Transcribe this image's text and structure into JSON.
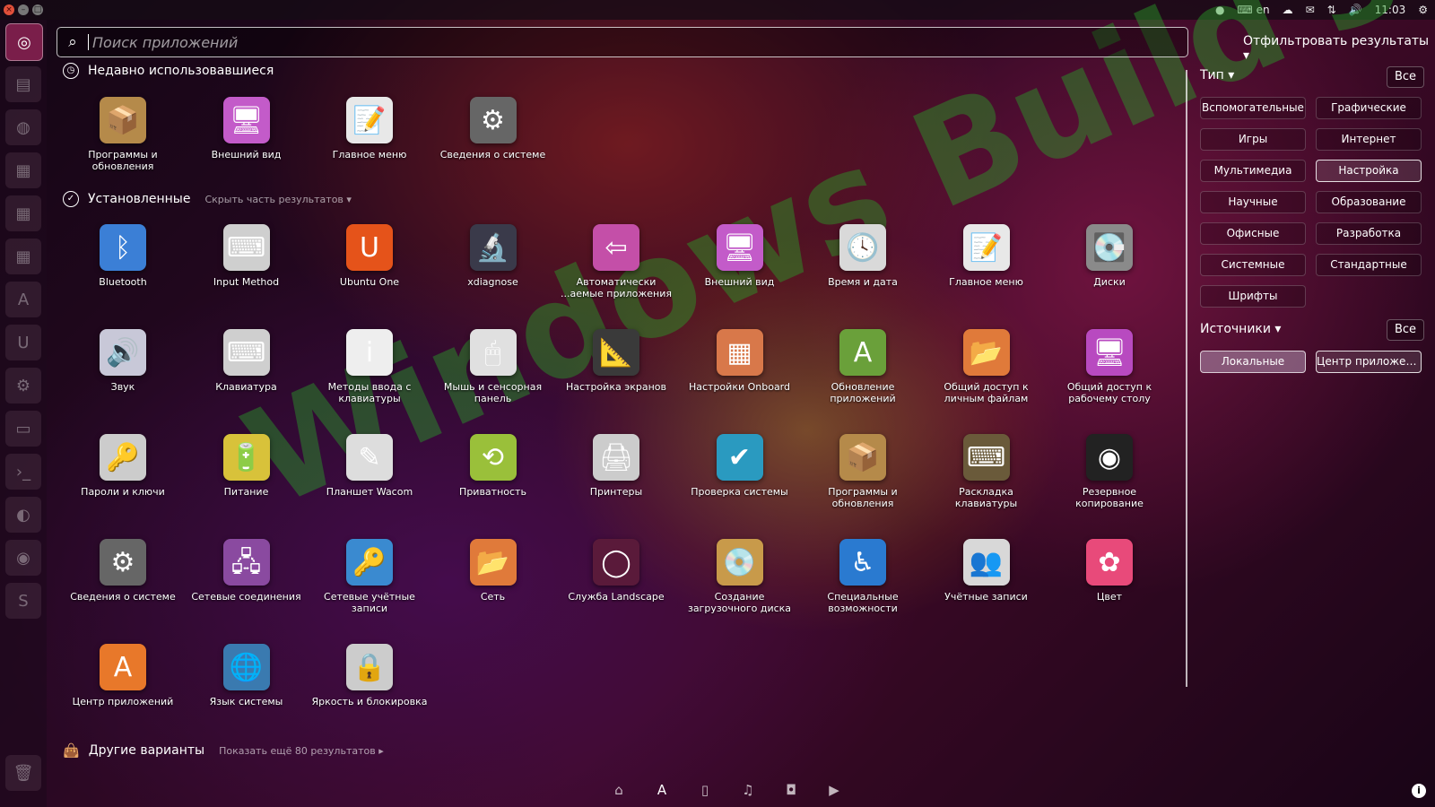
{
  "top_panel": {
    "keyboard_layout": "en",
    "time": "11:03"
  },
  "search": {
    "placeholder": "Поиск приложений"
  },
  "categories": {
    "recent": {
      "title": "Недавно использовавшиеся"
    },
    "installed": {
      "title": "Установленные",
      "toggle": "Скрыть часть результатов"
    },
    "other": {
      "title": "Другие варианты",
      "more": "Показать ещё 80 результатов"
    }
  },
  "recent_apps": [
    {
      "label": "Программы и обновления",
      "icon": "package-globe-icon",
      "glyph": "📦",
      "color": "#b58a4a"
    },
    {
      "label": "Внешний вид",
      "icon": "monitor-icon",
      "glyph": "🖥",
      "color": "#c35bc9"
    },
    {
      "label": "Главное меню",
      "icon": "menu-editor-icon",
      "glyph": "📝",
      "color": "#e8e8e8"
    },
    {
      "label": "Сведения о системе",
      "icon": "gear-icon",
      "glyph": "⚙",
      "color": "#666666"
    }
  ],
  "installed_apps": [
    {
      "label": "Bluetooth",
      "icon": "bluetooth-icon",
      "glyph": "ᛒ",
      "color": "#3b7fd6"
    },
    {
      "label": "Input Method",
      "icon": "keyboard-icon",
      "glyph": "⌨",
      "color": "#cfcfcf"
    },
    {
      "label": "Ubuntu One",
      "icon": "ubuntu-one-icon",
      "glyph": "U",
      "color": "#e5531a"
    },
    {
      "label": "xdiagnose",
      "icon": "microscope-icon",
      "glyph": "🔬",
      "color": "#3a3a4a"
    },
    {
      "label": "Автоматически ...аемые приложения",
      "icon": "startup-apps-icon",
      "glyph": "⇦",
      "color": "#c44fa8"
    },
    {
      "label": "Внешний вид",
      "icon": "monitor-icon",
      "glyph": "🖥",
      "color": "#c35bc9"
    },
    {
      "label": "Время и дата",
      "icon": "clock-icon",
      "glyph": "🕓",
      "color": "#d9d9d9"
    },
    {
      "label": "Главное меню",
      "icon": "menu-editor-icon",
      "glyph": "📝",
      "color": "#e8e8e8"
    },
    {
      "label": "Диски",
      "icon": "disks-icon",
      "glyph": "💽",
      "color": "#8a8a8a"
    },
    {
      "label": "Звук",
      "icon": "sound-icon",
      "glyph": "🔊",
      "color": "#c8c8d8"
    },
    {
      "label": "Клавиатура",
      "icon": "keyboard-icon",
      "glyph": "⌨",
      "color": "#cfcfcf"
    },
    {
      "label": "Методы ввода с клавиатуры",
      "icon": "info-icon",
      "glyph": "i",
      "color": "#eeeeee"
    },
    {
      "label": "Мышь и сенсорная панель",
      "icon": "mouse-icon",
      "glyph": "🖱",
      "color": "#e0e0e0"
    },
    {
      "label": "Настройка экранов",
      "icon": "display-icon",
      "glyph": "📐",
      "color": "#3a3a3a"
    },
    {
      "label": "Настройки Onboard",
      "icon": "onboard-icon",
      "glyph": "▦",
      "color": "#d8784a"
    },
    {
      "label": "Обновление приложений",
      "icon": "update-icon",
      "glyph": "A",
      "color": "#6aa03a"
    },
    {
      "label": "Общий доступ к личным файлам",
      "icon": "folder-share-icon",
      "glyph": "📂",
      "color": "#e07a3a"
    },
    {
      "label": "Общий доступ к рабочему столу",
      "icon": "desktop-share-icon",
      "glyph": "🖥",
      "color": "#b84ac0"
    },
    {
      "label": "Пароли и ключи",
      "icon": "keys-icon",
      "glyph": "🔑",
      "color": "#cccccc"
    },
    {
      "label": "Питание",
      "icon": "battery-icon",
      "glyph": "🔋",
      "color": "#d8c23a"
    },
    {
      "label": "Планшет Wacom",
      "icon": "tablet-icon",
      "glyph": "✎",
      "color": "#dddddd"
    },
    {
      "label": "Приватность",
      "icon": "privacy-icon",
      "glyph": "⟲",
      "color": "#9ac03a"
    },
    {
      "label": "Принтеры",
      "icon": "printer-icon",
      "glyph": "🖨",
      "color": "#cccccc"
    },
    {
      "label": "Проверка системы",
      "icon": "system-check-icon",
      "glyph": "✔",
      "color": "#2a9ac0"
    },
    {
      "label": "Программы и обновления",
      "icon": "package-globe-icon",
      "glyph": "📦",
      "color": "#b58a4a"
    },
    {
      "label": "Раскладка клавиатуры",
      "icon": "keyboard-layout-icon",
      "glyph": "⌨",
      "color": "#6a5a3a"
    },
    {
      "label": "Резервное копирование",
      "icon": "backup-safe-icon",
      "glyph": "◉",
      "color": "#222222"
    },
    {
      "label": "Сведения о системе",
      "icon": "gear-icon",
      "glyph": "⚙",
      "color": "#666666"
    },
    {
      "label": "Сетевые соединения",
      "icon": "network-icon",
      "glyph": "🖧",
      "color": "#8a4aa0"
    },
    {
      "label": "Сетевые учётные записи",
      "icon": "online-accounts-icon",
      "glyph": "🔑",
      "color": "#3a8ad0"
    },
    {
      "label": "Сеть",
      "icon": "network-folder-icon",
      "glyph": "📂",
      "color": "#e07a3a"
    },
    {
      "label": "Служба Landscape",
      "icon": "landscape-icon",
      "glyph": "◯",
      "color": "#5a1a3a"
    },
    {
      "label": "Создание загрузочного диска",
      "icon": "startup-disk-icon",
      "glyph": "💿",
      "color": "#c89a4a"
    },
    {
      "label": "Специальные возможности",
      "icon": "accessibility-icon",
      "glyph": "♿",
      "color": "#2a7ad0"
    },
    {
      "label": "Учётные записи",
      "icon": "users-icon",
      "glyph": "👥",
      "color": "#d8d8d8"
    },
    {
      "label": "Цвет",
      "icon": "color-icon",
      "glyph": "✿",
      "color": "#e84a7a"
    },
    {
      "label": "Центр приложений",
      "icon": "software-center-icon",
      "glyph": "A",
      "color": "#e8782a"
    },
    {
      "label": "Язык системы",
      "icon": "language-icon",
      "glyph": "🌐",
      "color": "#3a7ab0"
    },
    {
      "label": "Яркость и блокировка",
      "icon": "lock-screen-icon",
      "glyph": "🔒",
      "color": "#cccccc"
    }
  ],
  "filters": {
    "title": "Отфильтровать результаты",
    "type": {
      "label": "Тип",
      "all": "Все",
      "options": [
        {
          "label": "Вспомогательные",
          "active": false
        },
        {
          "label": "Графические",
          "active": false
        },
        {
          "label": "Игры",
          "active": false
        },
        {
          "label": "Интернет",
          "active": false
        },
        {
          "label": "Мультимедиа",
          "active": false
        },
        {
          "label": "Настройка",
          "active": true
        },
        {
          "label": "Научные",
          "active": false
        },
        {
          "label": "Образование",
          "active": false
        },
        {
          "label": "Офисные",
          "active": false
        },
        {
          "label": "Разработка",
          "active": false
        },
        {
          "label": "Системные",
          "active": false
        },
        {
          "label": "Стандартные",
          "active": false
        },
        {
          "label": "Шрифты",
          "active": false
        }
      ]
    },
    "sources": {
      "label": "Источники",
      "all": "Все",
      "options": [
        {
          "label": "Локальные",
          "active": true
        },
        {
          "label": "Центр приложен...",
          "active": false
        }
      ]
    }
  },
  "watermark": "Windows Build's"
}
